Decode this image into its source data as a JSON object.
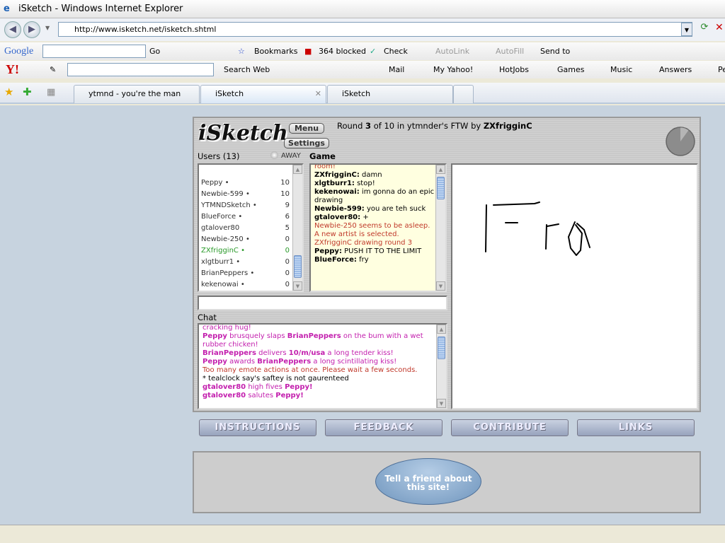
{
  "window": {
    "title": "iSketch - Windows Internet Explorer",
    "url": "http://www.isketch.net/isketch.shtml"
  },
  "google_toolbar": {
    "logo": "Google",
    "go": "Go",
    "bookmarks": "Bookmarks",
    "blocked": "364 blocked",
    "check": "Check",
    "autolink": "AutoLink",
    "autofill": "AutoFill",
    "sendto": "Send to"
  },
  "yahoo_toolbar": {
    "logo": "Y!",
    "search_web": "Search Web",
    "mail": "Mail",
    "myyahoo": "My Yahoo!",
    "hotjobs": "HotJobs",
    "games": "Games",
    "music": "Music",
    "answers": "Answers",
    "more": "Pe"
  },
  "tabs": [
    {
      "label": "ytmnd - you're the man now ..."
    },
    {
      "label": "iSketch",
      "active": true
    },
    {
      "label": "iSketch"
    }
  ],
  "game": {
    "logo": "iSketch",
    "menu": "Menu",
    "settings": "Settings",
    "round_pre": "Round ",
    "round": "3",
    "round_mid": " of 10 in ytmnder's FTW by ",
    "artist": "ZXfrigginC",
    "timer_elapsed_fraction": 0.9,
    "users_label": "Users (13)",
    "away": "AWAY",
    "game_label": "Game",
    "chat_label": "Chat",
    "users": [
      {
        "name": "Peppy •",
        "score": "10"
      },
      {
        "name": "Newbie-599 •",
        "score": "10"
      },
      {
        "name": "YTMNDSketch •",
        "score": "9"
      },
      {
        "name": "BlueForce •",
        "score": "6"
      },
      {
        "name": "gtalover80",
        "score": "5"
      },
      {
        "name": "Newbie-250 •",
        "score": "0"
      },
      {
        "name": "ZXfrigginC •",
        "score": "0",
        "drawing": true
      },
      {
        "name": "xlgtburr1 •",
        "score": "0"
      },
      {
        "name": "BrianPeppers •",
        "score": "0"
      },
      {
        "name": "kekenowai •",
        "score": "0"
      }
    ],
    "game_log": [
      {
        "type": "sys",
        "text": "room!"
      },
      {
        "who": "ZXfrigginC:",
        "text": " damn"
      },
      {
        "who": "xlgtburr1:",
        "text": " stop!"
      },
      {
        "who": "kekenowai:",
        "text": " im gonna do an epic drawing"
      },
      {
        "who": "Newbie-599:",
        "text": " you are teh suck"
      },
      {
        "who": "gtalover80:",
        "text": " +"
      },
      {
        "type": "sys",
        "text": "Newbie-250 seems to be asleep. A new artist is selected."
      },
      {
        "type": "sys",
        "text": "ZXfrigginC drawing round 3"
      },
      {
        "who": "Peppy:",
        "text": " PUSH IT TO THE LIMIT"
      },
      {
        "who": "BlueForce:",
        "text": " fry"
      }
    ],
    "guess_input": "",
    "chat_log": [
      {
        "parts": [
          [
            "",
            "cracking hug!"
          ]
        ]
      },
      {
        "parts": [
          [
            "b",
            "Peppy"
          ],
          [
            "",
            " brusquely slaps "
          ],
          [
            "b",
            "BrianPeppers"
          ],
          [
            "",
            " on the bum with a wet rubber chicken!"
          ]
        ]
      },
      {
        "parts": [
          [
            "b",
            "BrianPeppers"
          ],
          [
            "",
            " delivers "
          ],
          [
            "b",
            "10/m/usa"
          ],
          [
            "",
            " a long tender kiss!"
          ]
        ]
      },
      {
        "parts": [
          [
            "b",
            "Peppy"
          ],
          [
            "",
            " awards "
          ],
          [
            "b",
            "BrianPeppers"
          ],
          [
            "",
            " a long scintillating kiss!"
          ]
        ]
      },
      {
        "cls": "sys",
        "parts": [
          [
            "",
            "Too many emote actions at once. Please wait a few seconds."
          ]
        ]
      },
      {
        "cls": "plain",
        "parts": [
          [
            "",
            "* tealclock say's saftey is not gaurenteed"
          ]
        ]
      },
      {
        "parts": [
          [
            "b",
            "gtalover80"
          ],
          [
            "",
            " high fives "
          ],
          [
            "b",
            "Peppy!"
          ]
        ]
      },
      {
        "parts": [
          [
            "b",
            "gtalover80"
          ],
          [
            "",
            " salutes "
          ],
          [
            "b",
            "Peppy!"
          ]
        ]
      }
    ]
  },
  "nav_buttons": [
    "INSTRUCTIONS",
    "FEEDBACK",
    "CONTRIBUTE",
    "LINKS"
  ],
  "tell_friend": "Tell a friend about this site!"
}
